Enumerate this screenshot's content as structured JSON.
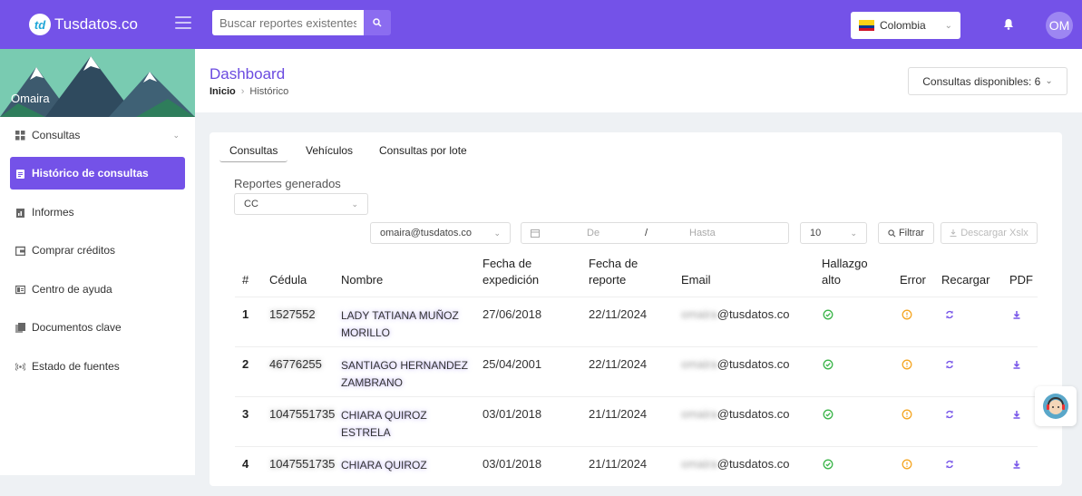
{
  "brand": {
    "logo_mark": "td",
    "name": "Tusdatos.co"
  },
  "search": {
    "placeholder": "Buscar reportes existentes"
  },
  "country": {
    "selected": "Colombia"
  },
  "user": {
    "initials": "OM",
    "name": "Omaira"
  },
  "sidebar": {
    "items": [
      {
        "label": "Consultas",
        "icon": "grid-icon"
      },
      {
        "label": "Histórico de consultas",
        "icon": "clipboard-icon"
      },
      {
        "label": "Informes",
        "icon": "report-icon"
      },
      {
        "label": "Comprar créditos",
        "icon": "wallet-icon"
      },
      {
        "label": "Centro de ayuda",
        "icon": "book-icon"
      },
      {
        "label": "Documentos clave",
        "icon": "documents-icon"
      },
      {
        "label": "Estado de fuentes",
        "icon": "broadcast-icon"
      }
    ]
  },
  "header": {
    "title": "Dashboard",
    "breadcrumb_home": "Inicio",
    "breadcrumb_current": "Histórico",
    "available_label": "Consultas disponibles: 6"
  },
  "tabs": [
    "Consultas",
    "Vehículos",
    "Consultas por lote"
  ],
  "filters": {
    "reports_label": "Reportes generados",
    "doc_type": "CC",
    "email_filter": "omaira@tusdatos.co",
    "date_from_placeholder": "De",
    "date_separator": "/",
    "date_to_placeholder": "Hasta",
    "page_size": "10",
    "filter_button": "Filtrar",
    "download_button": "Descargar Xslx"
  },
  "table": {
    "headers": {
      "num": "#",
      "cedula": "Cédula",
      "nombre": "Nombre",
      "fecha_exp_1": "Fecha de",
      "fecha_exp_2": "expedición",
      "fecha_rep_1": "Fecha de",
      "fecha_rep_2": "reporte",
      "email": "Email",
      "hallazgo_1": "Hallazgo",
      "hallazgo_2": "alto",
      "error": "Error",
      "recargar": "Recargar",
      "pdf": "PDF"
    },
    "rows": [
      {
        "num": "1",
        "cedula": "1527552",
        "nombre_1": "LADY TATIANA MUÑOZ",
        "nombre_2": "MORILLO",
        "fecha_exp": "27/06/2018",
        "fecha_rep": "22/11/2024",
        "email_user": "omaira",
        "email_domain": "@tusdatos.co"
      },
      {
        "num": "2",
        "cedula": "46776255",
        "nombre_1": "SANTIAGO HERNANDEZ",
        "nombre_2": "ZAMBRANO",
        "fecha_exp": "25/04/2001",
        "fecha_rep": "22/11/2024",
        "email_user": "omaira",
        "email_domain": "@tusdatos.co"
      },
      {
        "num": "3",
        "cedula": "1047551735",
        "nombre_1": "CHIARA QUIROZ",
        "nombre_2": "ESTRELA",
        "fecha_exp": "03/01/2018",
        "fecha_rep": "21/11/2024",
        "email_user": "omaira",
        "email_domain": "@tusdatos.co"
      },
      {
        "num": "4",
        "cedula": "1047551735",
        "nombre_1": "CHIARA QUIROZ",
        "nombre_2": "",
        "fecha_exp": "03/01/2018",
        "fecha_rep": "21/11/2024",
        "email_user": "omaira",
        "email_domain": "@tusdatos.co"
      }
    ]
  },
  "colors": {
    "primary": "#7452e8",
    "success": "#3bb54a",
    "warning": "#f5a623"
  }
}
